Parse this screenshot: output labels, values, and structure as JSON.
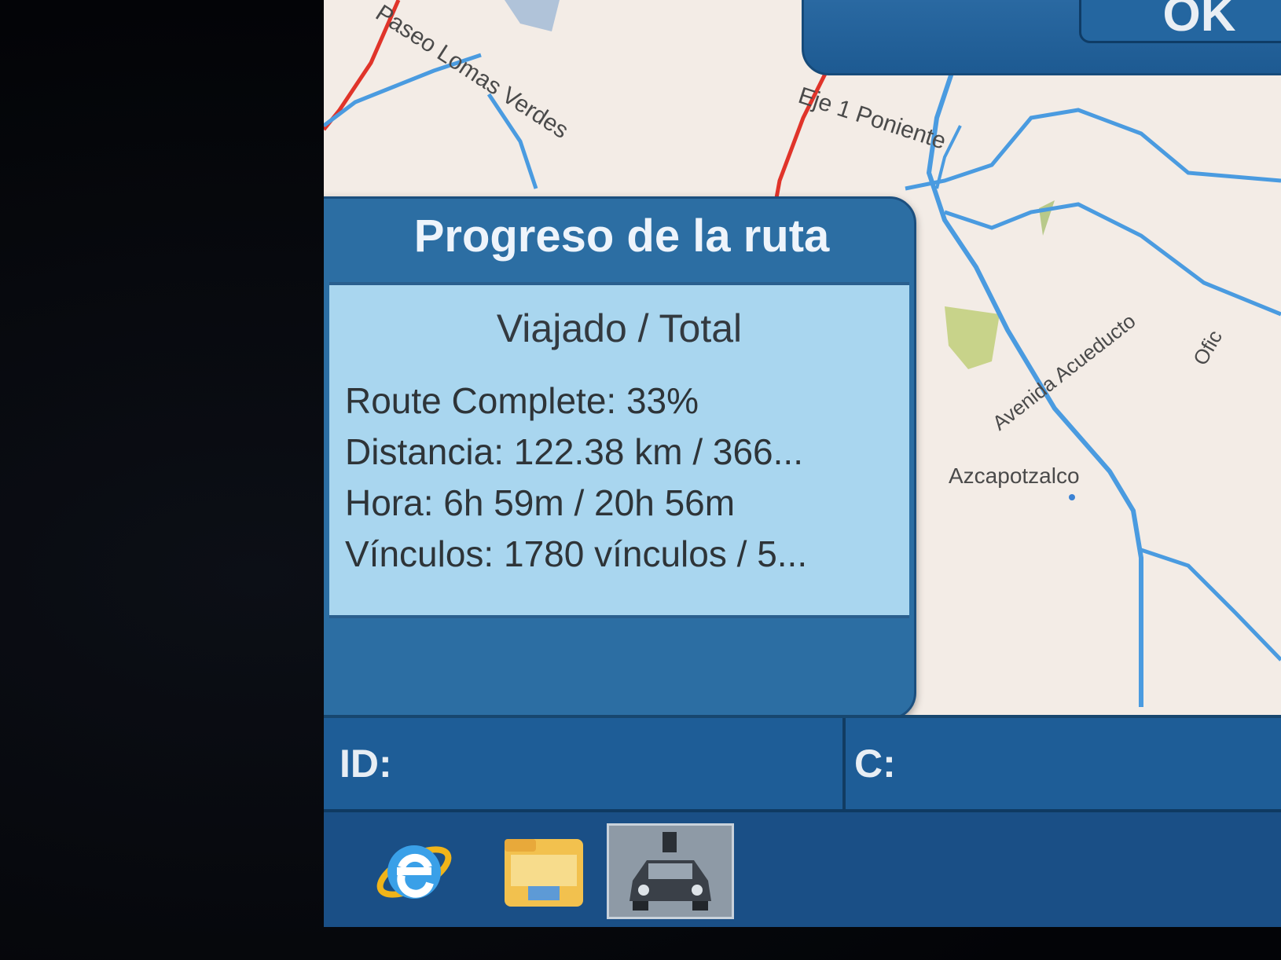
{
  "map": {
    "labels": {
      "street1": "Paseo Lomas Verdes",
      "street2": "Eje 1 Poniente",
      "street3": "Avenida Acueducto",
      "place": "Azcapotzalco",
      "partial": "Ofic"
    },
    "colors": {
      "road_blue": "#4a9be0",
      "road_red": "#e0342a",
      "park_green": "#c8d38a",
      "background": "#f3ece6"
    }
  },
  "top_bar": {
    "ok_label": "OK"
  },
  "dialog": {
    "title": "Progreso de la ruta",
    "subtitle": "Viajado / Total",
    "route_complete": "Route Complete: 33%",
    "distance": "Distancia: 122.38 km / 366...",
    "time": "Hora: 6h 59m / 20h 56m",
    "links": "Vínculos: 1780 vínculos / 5..."
  },
  "status_bar": {
    "id_label": "ID:",
    "c_label": "C:"
  },
  "taskbar": {
    "icons": [
      "internet-explorer-icon",
      "folder-icon",
      "car-navigation-icon"
    ]
  }
}
